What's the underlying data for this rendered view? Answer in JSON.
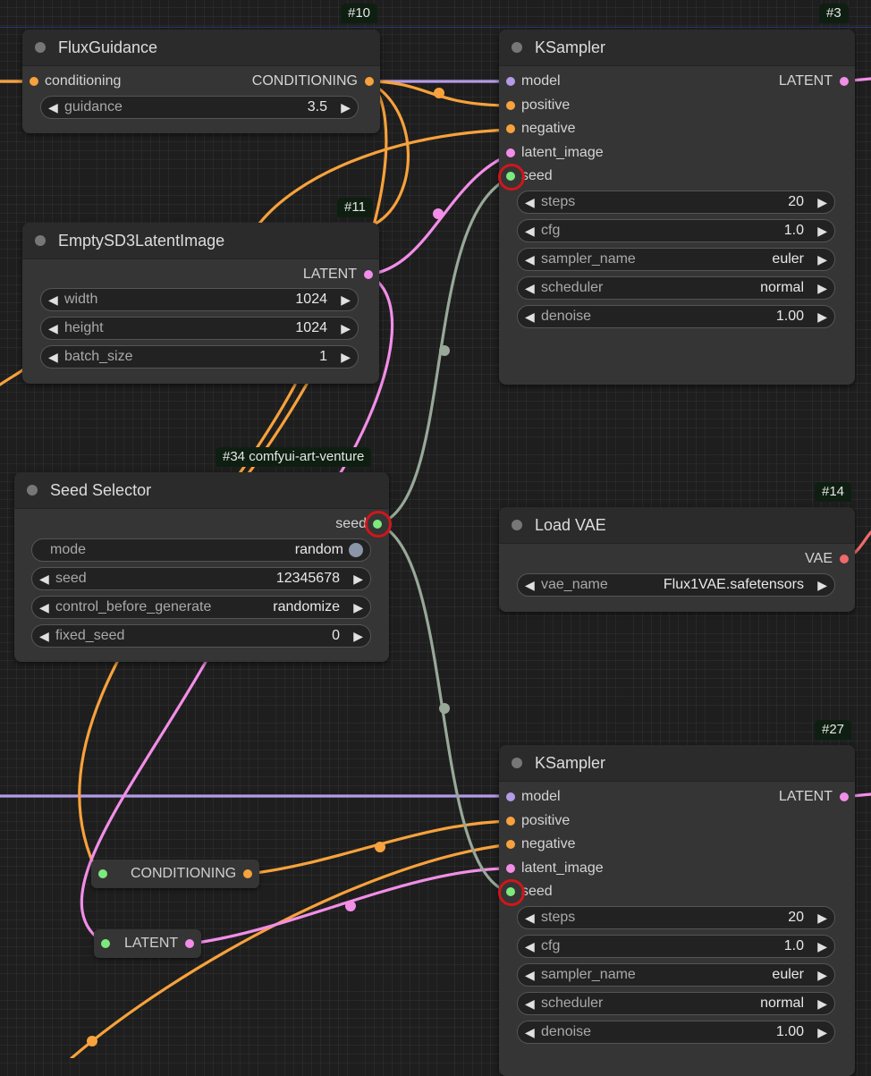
{
  "colors": {
    "conditioning": "#f7a23c",
    "latent": "#f28ee8",
    "model": "#b49be8",
    "seed": "#7dea7d",
    "seed_link": "#98a899",
    "vae": "#f06a6a",
    "highlight": "#d0161b"
  },
  "nodes": {
    "flux_guidance": {
      "badge": "#10",
      "title": "FluxGuidance",
      "input_label": "conditioning",
      "output_label": "CONDITIONING",
      "widgets": [
        {
          "label": "guidance",
          "value": "3.5"
        }
      ]
    },
    "ksampler_top": {
      "badge": "#3",
      "title": "KSampler",
      "inputs": [
        "model",
        "positive",
        "negative",
        "latent_image",
        "seed"
      ],
      "output_label": "LATENT",
      "widgets": [
        {
          "label": "steps",
          "value": "20"
        },
        {
          "label": "cfg",
          "value": "1.0"
        },
        {
          "label": "sampler_name",
          "value": "euler"
        },
        {
          "label": "scheduler",
          "value": "normal"
        },
        {
          "label": "denoise",
          "value": "1.00"
        }
      ]
    },
    "empty_latent": {
      "badge": "#11",
      "title": "EmptySD3LatentImage",
      "output_label": "LATENT",
      "widgets": [
        {
          "label": "width",
          "value": "1024"
        },
        {
          "label": "height",
          "value": "1024"
        },
        {
          "label": "batch_size",
          "value": "1"
        }
      ]
    },
    "seed_selector": {
      "badge": "#34 comfyui-art-venture",
      "title": "Seed Selector",
      "output_label": "seed",
      "mode": {
        "label": "mode",
        "value": "random"
      },
      "widgets": [
        {
          "label": "seed",
          "value": "12345678"
        },
        {
          "label": "control_before_generate",
          "value": "randomize"
        },
        {
          "label": "fixed_seed",
          "value": "0"
        }
      ]
    },
    "load_vae": {
      "badge": "#14",
      "title": "Load VAE",
      "output_label": "VAE",
      "widgets": [
        {
          "label": "vae_name",
          "value": "Flux1VAE.safetensors"
        }
      ]
    },
    "ksampler_bottom": {
      "badge": "#27",
      "title": "KSampler",
      "inputs": [
        "model",
        "positive",
        "negative",
        "latent_image",
        "seed"
      ],
      "output_label": "LATENT",
      "widgets": [
        {
          "label": "steps",
          "value": "20"
        },
        {
          "label": "cfg",
          "value": "1.0"
        },
        {
          "label": "sampler_name",
          "value": "euler"
        },
        {
          "label": "scheduler",
          "value": "normal"
        },
        {
          "label": "denoise",
          "value": "1.00"
        }
      ]
    }
  },
  "reroutes": {
    "conditioning": "CONDITIONING",
    "latent": "LATENT"
  },
  "arrows": {
    "left": "◀",
    "right": "▶"
  }
}
